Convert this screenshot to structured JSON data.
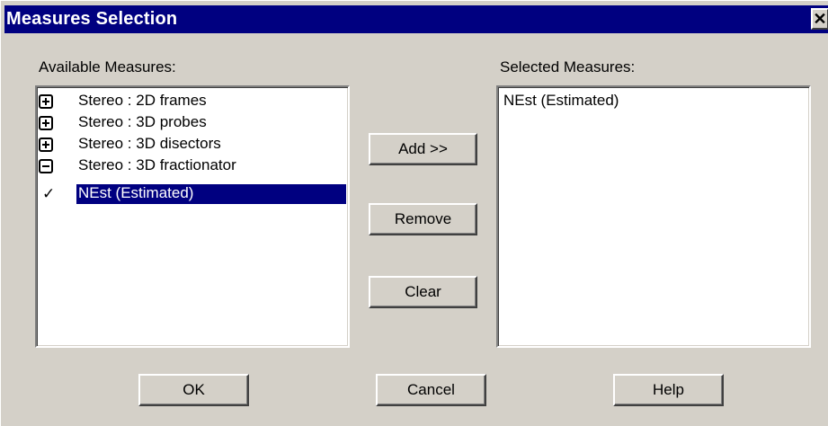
{
  "window": {
    "title": "Measures Selection",
    "close_glyph": "✕"
  },
  "available": {
    "label": "Available Measures:",
    "items": [
      {
        "label": "Stereo : 2D frames",
        "marker": "plus-box-icon"
      },
      {
        "label": "Stereo : 3D probes",
        "marker": "plus-box-icon"
      },
      {
        "label": "Stereo : 3D disectors",
        "marker": "plus-box-icon"
      },
      {
        "label": "Stereo : 3D fractionator",
        "marker": "minus-box-icon"
      },
      {
        "label": "NEst (Estimated)",
        "marker": "checkmark-icon",
        "selected": true
      }
    ],
    "check_glyph": "✓"
  },
  "selected": {
    "label": "Selected Measures:",
    "items": [
      {
        "label": "NEst (Estimated)"
      }
    ]
  },
  "buttons": {
    "add": "Add >>",
    "remove": "Remove",
    "clear": "Clear",
    "ok": "OK",
    "cancel": "Cancel",
    "help": "Help"
  },
  "colors": {
    "titlebar": "#000080",
    "face": "#d4d0c8",
    "selection": "#000080"
  }
}
